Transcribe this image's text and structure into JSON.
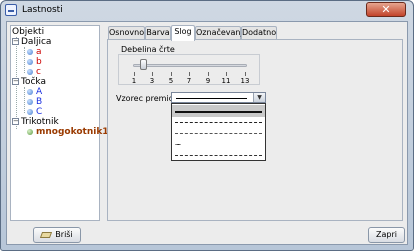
{
  "window": {
    "title": "Lastnosti",
    "close_label": "✕"
  },
  "tree": {
    "root_label": "Objekti",
    "groups": [
      {
        "label": "Daljica",
        "items": [
          {
            "label": "a",
            "color": "#cc0000"
          },
          {
            "label": "b",
            "color": "#cc0000"
          },
          {
            "label": "c",
            "color": "#cc0000"
          }
        ]
      },
      {
        "label": "Točka",
        "items": [
          {
            "label": "A",
            "color": "#1a2fe0"
          },
          {
            "label": "B",
            "color": "#1a2fe0"
          },
          {
            "label": "C",
            "color": "#1a2fe0"
          }
        ]
      },
      {
        "label": "Trikotnik",
        "items": [
          {
            "label": "mnogokotnik1",
            "color": "#9a3a00"
          }
        ]
      }
    ]
  },
  "tabs": [
    "Osnovno",
    "Barva",
    "Slog",
    "Označevanje",
    "Dodatno"
  ],
  "active_tab": "Slog",
  "style_tab": {
    "thickness_label": "Debelina črte",
    "slider_ticks": [
      "1",
      "3",
      "5",
      "7",
      "9",
      "11",
      "13"
    ],
    "slider_value": 2,
    "pattern_label": "Vzorec premice:",
    "pattern_options": [
      "solid",
      "dash-long",
      "dash-short",
      "dot",
      "dashdot"
    ]
  },
  "buttons": {
    "delete": "Briši",
    "close": "Zapri"
  }
}
